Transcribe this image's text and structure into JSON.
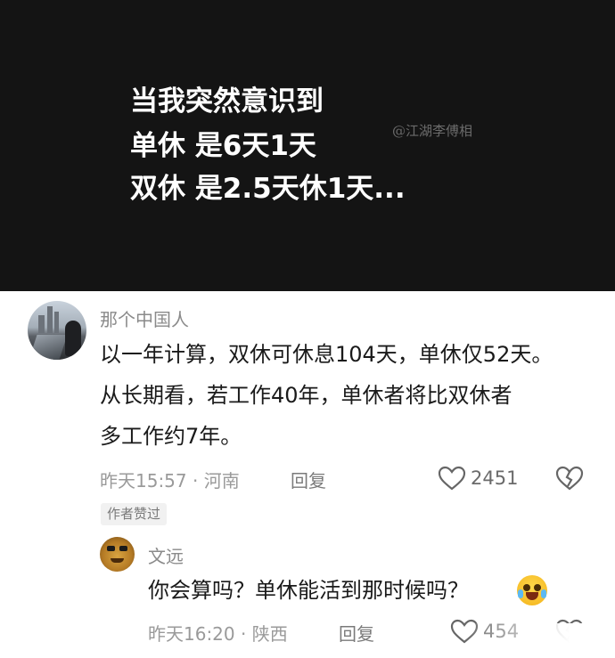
{
  "banner": {
    "lines": [
      "当我突然意识到",
      "单休 是6天1天",
      "双休 是2.5天休1天..."
    ],
    "watermark": "@江湖李傅相",
    "bg_color": "#141414"
  },
  "comments": [
    {
      "author": "那个中国人",
      "text_lines": [
        "以一年计算，双休可休息104天，单休仅52天。",
        "从长期看，若工作40年，单休者将比双休者",
        "多工作约7年。"
      ],
      "time": "昨天15:57",
      "location": "河南",
      "reply_label": "回复",
      "likes": "2451",
      "badge": "作者赞过"
    },
    {
      "author": "文远",
      "text": "你会算吗？单休能活到那时候吗？",
      "emoji": "crying-laughing-emoji",
      "time": "昨天16:20",
      "location": "陕西",
      "reply_label": "回复",
      "likes": "454"
    }
  ],
  "icons": {
    "like": "heart-outline-icon",
    "dislike": "broken-heart-icon"
  }
}
